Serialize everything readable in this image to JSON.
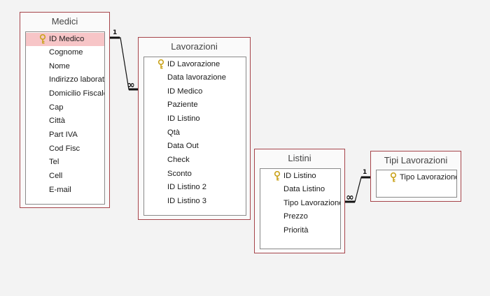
{
  "tables": {
    "medici": {
      "title": "Medici",
      "fields": [
        "ID Medico",
        "Cognome",
        "Nome",
        "Indirizzo laborat",
        "Domicilio Fiscale",
        "Cap",
        "Città",
        "Part IVA",
        "Cod Fisc",
        "Tel",
        "Cell",
        "E-mail"
      ]
    },
    "lavorazioni": {
      "title": "Lavorazioni",
      "fields": [
        "ID Lavorazione",
        "Data lavorazione",
        "ID Medico",
        "Paziente",
        "ID Listino",
        "Qtà",
        "Data Out",
        "Check",
        "Sconto",
        "ID Listino 2",
        "ID Listino 3"
      ]
    },
    "listini": {
      "title": "Listini",
      "fields": [
        "ID Listino",
        "Data Listino",
        "Tipo Lavorazione",
        "Prezzo",
        "Priorità"
      ]
    },
    "tipi_lavorazioni": {
      "title": "Tipi Lavorazioni",
      "fields": [
        "Tipo Lavorazione"
      ]
    }
  },
  "relationships": {
    "medici_lavorazioni": {
      "one_label": "1",
      "many_label": "∞"
    },
    "tipi_listini": {
      "one_label": "1",
      "many_label": "∞"
    }
  },
  "colors": {
    "table_border": "#a6444a",
    "selected_row": "#f7c5c7",
    "canvas_bg": "#f3f3f3",
    "key_icon": "#c9a21a"
  }
}
